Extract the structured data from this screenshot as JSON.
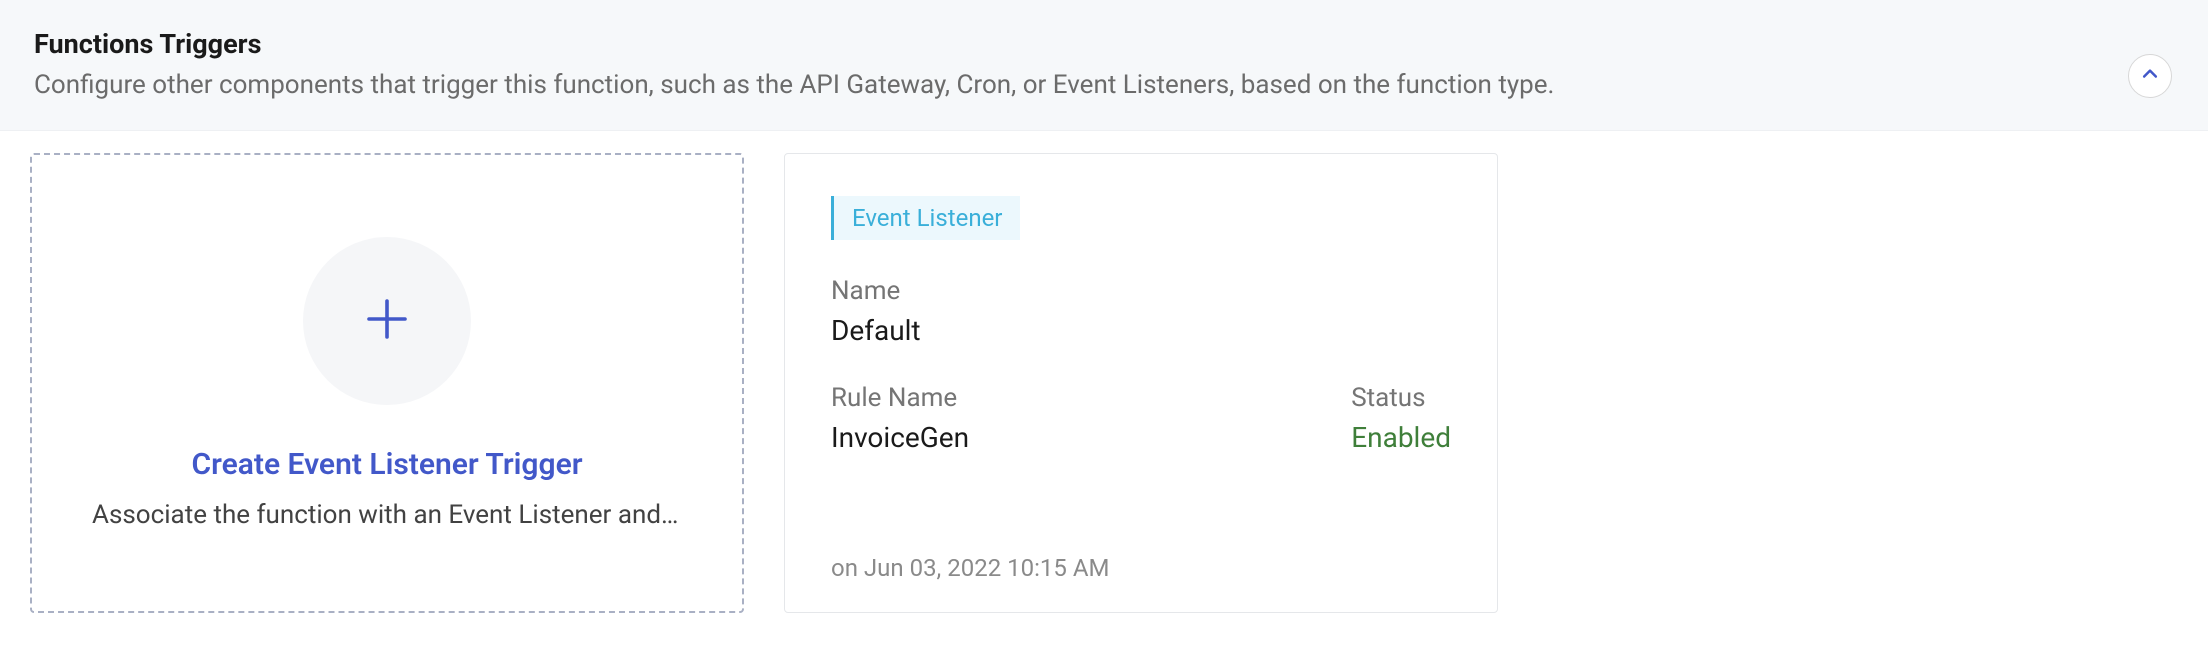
{
  "header": {
    "title": "Functions Triggers",
    "subtitle": "Configure other components that trigger this function, such as the API Gateway, Cron, or Event Listeners, based on the function type."
  },
  "create_card": {
    "title": "Create Event Listener Trigger",
    "description": "Associate the function with an Event Listener and c…"
  },
  "trigger_card": {
    "badge": "Event Listener",
    "name_label": "Name",
    "name_value": "Default",
    "rule_label": "Rule Name",
    "rule_value": "InvoiceGen",
    "status_label": "Status",
    "status_value": "Enabled",
    "timestamp": "on Jun 03, 2022 10:15 AM"
  }
}
